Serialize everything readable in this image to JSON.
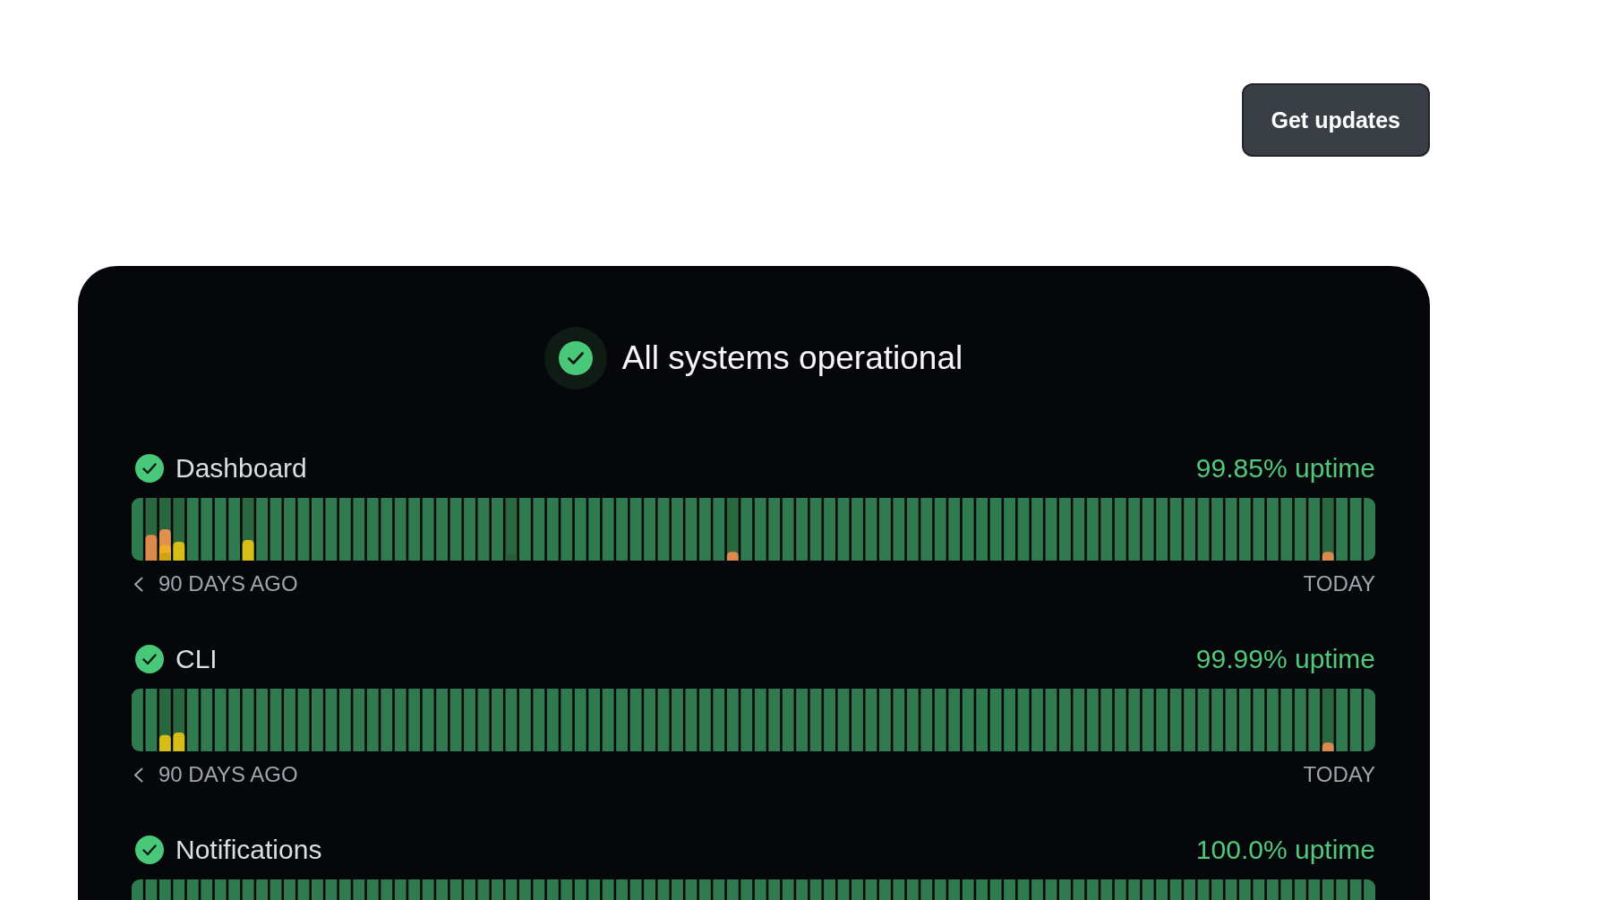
{
  "top_bar": {
    "button": {
      "label": "Get updates"
    }
  },
  "overall": {
    "title": "All systems operational"
  },
  "services": [
    {
      "name": "Dashboard",
      "uptime": "99.85% uptime",
      "range_start": "90 DAYS AGO",
      "range_end": "TODAY",
      "days": [
        {
          "kind": "ok"
        },
        {
          "kind": "incident",
          "segments": [
            {
              "color": "#dc8a4c",
              "level": 0.41
            }
          ]
        },
        {
          "kind": "incident",
          "segments": [
            {
              "color": "#e0914f",
              "level": 0.5
            },
            {
              "color": "#f0ad27",
              "level": 0.25
            },
            {
              "color": "#cfa514",
              "level": 0.13
            }
          ]
        },
        {
          "kind": "incident",
          "segments": [
            {
              "color": "#d6bd17",
              "level": 0.3
            }
          ]
        },
        {
          "kind": "ok"
        },
        {
          "kind": "ok"
        },
        {
          "kind": "ok"
        },
        {
          "kind": "ok"
        },
        {
          "kind": "incident",
          "segments": [
            {
              "color": "#d6bd17",
              "level": 0.33
            }
          ]
        },
        {
          "kind": "ok"
        },
        {
          "kind": "ok"
        },
        {
          "kind": "ok"
        },
        {
          "kind": "ok"
        },
        {
          "kind": "ok"
        },
        {
          "kind": "ok"
        },
        {
          "kind": "ok"
        },
        {
          "kind": "ok"
        },
        {
          "kind": "ok"
        },
        {
          "kind": "ok"
        },
        {
          "kind": "ok"
        },
        {
          "kind": "ok"
        },
        {
          "kind": "ok"
        },
        {
          "kind": "ok"
        },
        {
          "kind": "ok"
        },
        {
          "kind": "ok"
        },
        {
          "kind": "ok"
        },
        {
          "kind": "ok"
        },
        {
          "kind": "incident",
          "segments": [
            {
              "color": "#285e3d",
              "level": 0.1
            }
          ]
        },
        {
          "kind": "ok"
        },
        {
          "kind": "ok"
        },
        {
          "kind": "ok"
        },
        {
          "kind": "ok"
        },
        {
          "kind": "ok"
        },
        {
          "kind": "ok"
        },
        {
          "kind": "ok"
        },
        {
          "kind": "ok"
        },
        {
          "kind": "ok"
        },
        {
          "kind": "ok"
        },
        {
          "kind": "ok"
        },
        {
          "kind": "ok"
        },
        {
          "kind": "ok"
        },
        {
          "kind": "ok"
        },
        {
          "kind": "ok"
        },
        {
          "kind": "incident",
          "segments": [
            {
              "color": "#dc8a4c",
              "level": 0.14
            }
          ]
        },
        {
          "kind": "ok"
        },
        {
          "kind": "ok"
        },
        {
          "kind": "ok"
        },
        {
          "kind": "ok"
        },
        {
          "kind": "ok"
        },
        {
          "kind": "ok"
        },
        {
          "kind": "ok"
        },
        {
          "kind": "ok"
        },
        {
          "kind": "ok"
        },
        {
          "kind": "ok"
        },
        {
          "kind": "ok"
        },
        {
          "kind": "ok"
        },
        {
          "kind": "ok"
        },
        {
          "kind": "ok"
        },
        {
          "kind": "ok"
        },
        {
          "kind": "ok"
        },
        {
          "kind": "ok"
        },
        {
          "kind": "ok"
        },
        {
          "kind": "ok"
        },
        {
          "kind": "ok"
        },
        {
          "kind": "ok"
        },
        {
          "kind": "ok"
        },
        {
          "kind": "ok"
        },
        {
          "kind": "ok"
        },
        {
          "kind": "ok"
        },
        {
          "kind": "ok"
        },
        {
          "kind": "ok"
        },
        {
          "kind": "ok"
        },
        {
          "kind": "ok"
        },
        {
          "kind": "ok"
        },
        {
          "kind": "ok"
        },
        {
          "kind": "ok"
        },
        {
          "kind": "ok"
        },
        {
          "kind": "ok"
        },
        {
          "kind": "ok"
        },
        {
          "kind": "ok"
        },
        {
          "kind": "ok"
        },
        {
          "kind": "ok"
        },
        {
          "kind": "ok"
        },
        {
          "kind": "ok"
        },
        {
          "kind": "ok"
        },
        {
          "kind": "ok"
        },
        {
          "kind": "incident",
          "segments": [
            {
              "color": "#dc8a4c",
              "level": 0.14
            }
          ]
        },
        {
          "kind": "ok"
        },
        {
          "kind": "ok"
        },
        {
          "kind": "ok"
        }
      ]
    },
    {
      "name": "CLI",
      "uptime": "99.99% uptime",
      "range_start": "90 DAYS AGO",
      "range_end": "TODAY",
      "days": [
        {
          "kind": "ok"
        },
        {
          "kind": "ok"
        },
        {
          "kind": "incident",
          "segments": [
            {
              "color": "#d6bd17",
              "level": 0.26
            }
          ]
        },
        {
          "kind": "incident",
          "segments": [
            {
              "color": "#d6bd17",
              "level": 0.3
            }
          ]
        },
        {
          "kind": "ok"
        },
        {
          "kind": "ok"
        },
        {
          "kind": "ok"
        },
        {
          "kind": "ok"
        },
        {
          "kind": "ok"
        },
        {
          "kind": "ok"
        },
        {
          "kind": "ok"
        },
        {
          "kind": "ok"
        },
        {
          "kind": "ok"
        },
        {
          "kind": "ok"
        },
        {
          "kind": "ok"
        },
        {
          "kind": "ok"
        },
        {
          "kind": "ok"
        },
        {
          "kind": "ok"
        },
        {
          "kind": "ok"
        },
        {
          "kind": "ok"
        },
        {
          "kind": "ok"
        },
        {
          "kind": "ok"
        },
        {
          "kind": "ok"
        },
        {
          "kind": "ok"
        },
        {
          "kind": "ok"
        },
        {
          "kind": "ok"
        },
        {
          "kind": "ok"
        },
        {
          "kind": "ok"
        },
        {
          "kind": "ok"
        },
        {
          "kind": "ok"
        },
        {
          "kind": "ok"
        },
        {
          "kind": "ok"
        },
        {
          "kind": "ok"
        },
        {
          "kind": "ok"
        },
        {
          "kind": "ok"
        },
        {
          "kind": "ok"
        },
        {
          "kind": "ok"
        },
        {
          "kind": "ok"
        },
        {
          "kind": "ok"
        },
        {
          "kind": "ok"
        },
        {
          "kind": "ok"
        },
        {
          "kind": "ok"
        },
        {
          "kind": "ok"
        },
        {
          "kind": "ok"
        },
        {
          "kind": "ok"
        },
        {
          "kind": "ok"
        },
        {
          "kind": "ok"
        },
        {
          "kind": "ok"
        },
        {
          "kind": "ok"
        },
        {
          "kind": "ok"
        },
        {
          "kind": "ok"
        },
        {
          "kind": "ok"
        },
        {
          "kind": "ok"
        },
        {
          "kind": "ok"
        },
        {
          "kind": "ok"
        },
        {
          "kind": "ok"
        },
        {
          "kind": "ok"
        },
        {
          "kind": "ok"
        },
        {
          "kind": "ok"
        },
        {
          "kind": "ok"
        },
        {
          "kind": "ok"
        },
        {
          "kind": "ok"
        },
        {
          "kind": "ok"
        },
        {
          "kind": "ok"
        },
        {
          "kind": "ok"
        },
        {
          "kind": "ok"
        },
        {
          "kind": "ok"
        },
        {
          "kind": "ok"
        },
        {
          "kind": "ok"
        },
        {
          "kind": "ok"
        },
        {
          "kind": "ok"
        },
        {
          "kind": "ok"
        },
        {
          "kind": "ok"
        },
        {
          "kind": "ok"
        },
        {
          "kind": "ok"
        },
        {
          "kind": "ok"
        },
        {
          "kind": "ok"
        },
        {
          "kind": "ok"
        },
        {
          "kind": "ok"
        },
        {
          "kind": "ok"
        },
        {
          "kind": "ok"
        },
        {
          "kind": "ok"
        },
        {
          "kind": "ok"
        },
        {
          "kind": "ok"
        },
        {
          "kind": "ok"
        },
        {
          "kind": "ok"
        },
        {
          "kind": "incident",
          "segments": [
            {
              "color": "#dc8a4c",
              "level": 0.14
            }
          ]
        },
        {
          "kind": "ok"
        },
        {
          "kind": "ok"
        },
        {
          "kind": "ok"
        }
      ]
    },
    {
      "name": "Notifications",
      "uptime": "100.0% uptime",
      "days": [
        {
          "kind": "ok"
        },
        {
          "kind": "ok"
        },
        {
          "kind": "ok"
        },
        {
          "kind": "ok"
        },
        {
          "kind": "ok"
        },
        {
          "kind": "ok"
        },
        {
          "kind": "ok"
        },
        {
          "kind": "ok"
        },
        {
          "kind": "ok"
        },
        {
          "kind": "ok"
        },
        {
          "kind": "ok"
        },
        {
          "kind": "ok"
        },
        {
          "kind": "ok"
        },
        {
          "kind": "ok"
        },
        {
          "kind": "ok"
        },
        {
          "kind": "ok"
        },
        {
          "kind": "ok"
        },
        {
          "kind": "ok"
        },
        {
          "kind": "ok"
        },
        {
          "kind": "ok"
        },
        {
          "kind": "ok"
        },
        {
          "kind": "ok"
        },
        {
          "kind": "ok"
        },
        {
          "kind": "ok"
        },
        {
          "kind": "ok"
        },
        {
          "kind": "ok"
        },
        {
          "kind": "ok"
        },
        {
          "kind": "ok"
        },
        {
          "kind": "ok"
        },
        {
          "kind": "ok"
        },
        {
          "kind": "ok"
        },
        {
          "kind": "ok"
        },
        {
          "kind": "ok"
        },
        {
          "kind": "ok"
        },
        {
          "kind": "ok"
        },
        {
          "kind": "ok"
        },
        {
          "kind": "ok"
        },
        {
          "kind": "ok"
        },
        {
          "kind": "ok"
        },
        {
          "kind": "ok"
        },
        {
          "kind": "ok"
        },
        {
          "kind": "ok"
        },
        {
          "kind": "ok"
        },
        {
          "kind": "ok"
        },
        {
          "kind": "ok"
        },
        {
          "kind": "ok"
        },
        {
          "kind": "ok"
        },
        {
          "kind": "ok"
        },
        {
          "kind": "ok"
        },
        {
          "kind": "ok"
        },
        {
          "kind": "ok"
        },
        {
          "kind": "ok"
        },
        {
          "kind": "ok"
        },
        {
          "kind": "ok"
        },
        {
          "kind": "ok"
        },
        {
          "kind": "ok"
        },
        {
          "kind": "ok"
        },
        {
          "kind": "ok"
        },
        {
          "kind": "ok"
        },
        {
          "kind": "ok"
        },
        {
          "kind": "ok"
        },
        {
          "kind": "ok"
        },
        {
          "kind": "ok"
        },
        {
          "kind": "ok"
        },
        {
          "kind": "ok"
        },
        {
          "kind": "ok"
        },
        {
          "kind": "ok"
        },
        {
          "kind": "ok"
        },
        {
          "kind": "ok"
        },
        {
          "kind": "ok"
        },
        {
          "kind": "ok"
        },
        {
          "kind": "ok"
        },
        {
          "kind": "ok"
        },
        {
          "kind": "ok"
        },
        {
          "kind": "ok"
        },
        {
          "kind": "ok"
        },
        {
          "kind": "ok"
        },
        {
          "kind": "ok"
        },
        {
          "kind": "ok"
        },
        {
          "kind": "ok"
        },
        {
          "kind": "ok"
        },
        {
          "kind": "ok"
        },
        {
          "kind": "ok"
        },
        {
          "kind": "ok"
        },
        {
          "kind": "ok"
        },
        {
          "kind": "ok"
        },
        {
          "kind": "ok"
        },
        {
          "kind": "ok"
        },
        {
          "kind": "ok"
        },
        {
          "kind": "ok"
        }
      ]
    }
  ]
}
